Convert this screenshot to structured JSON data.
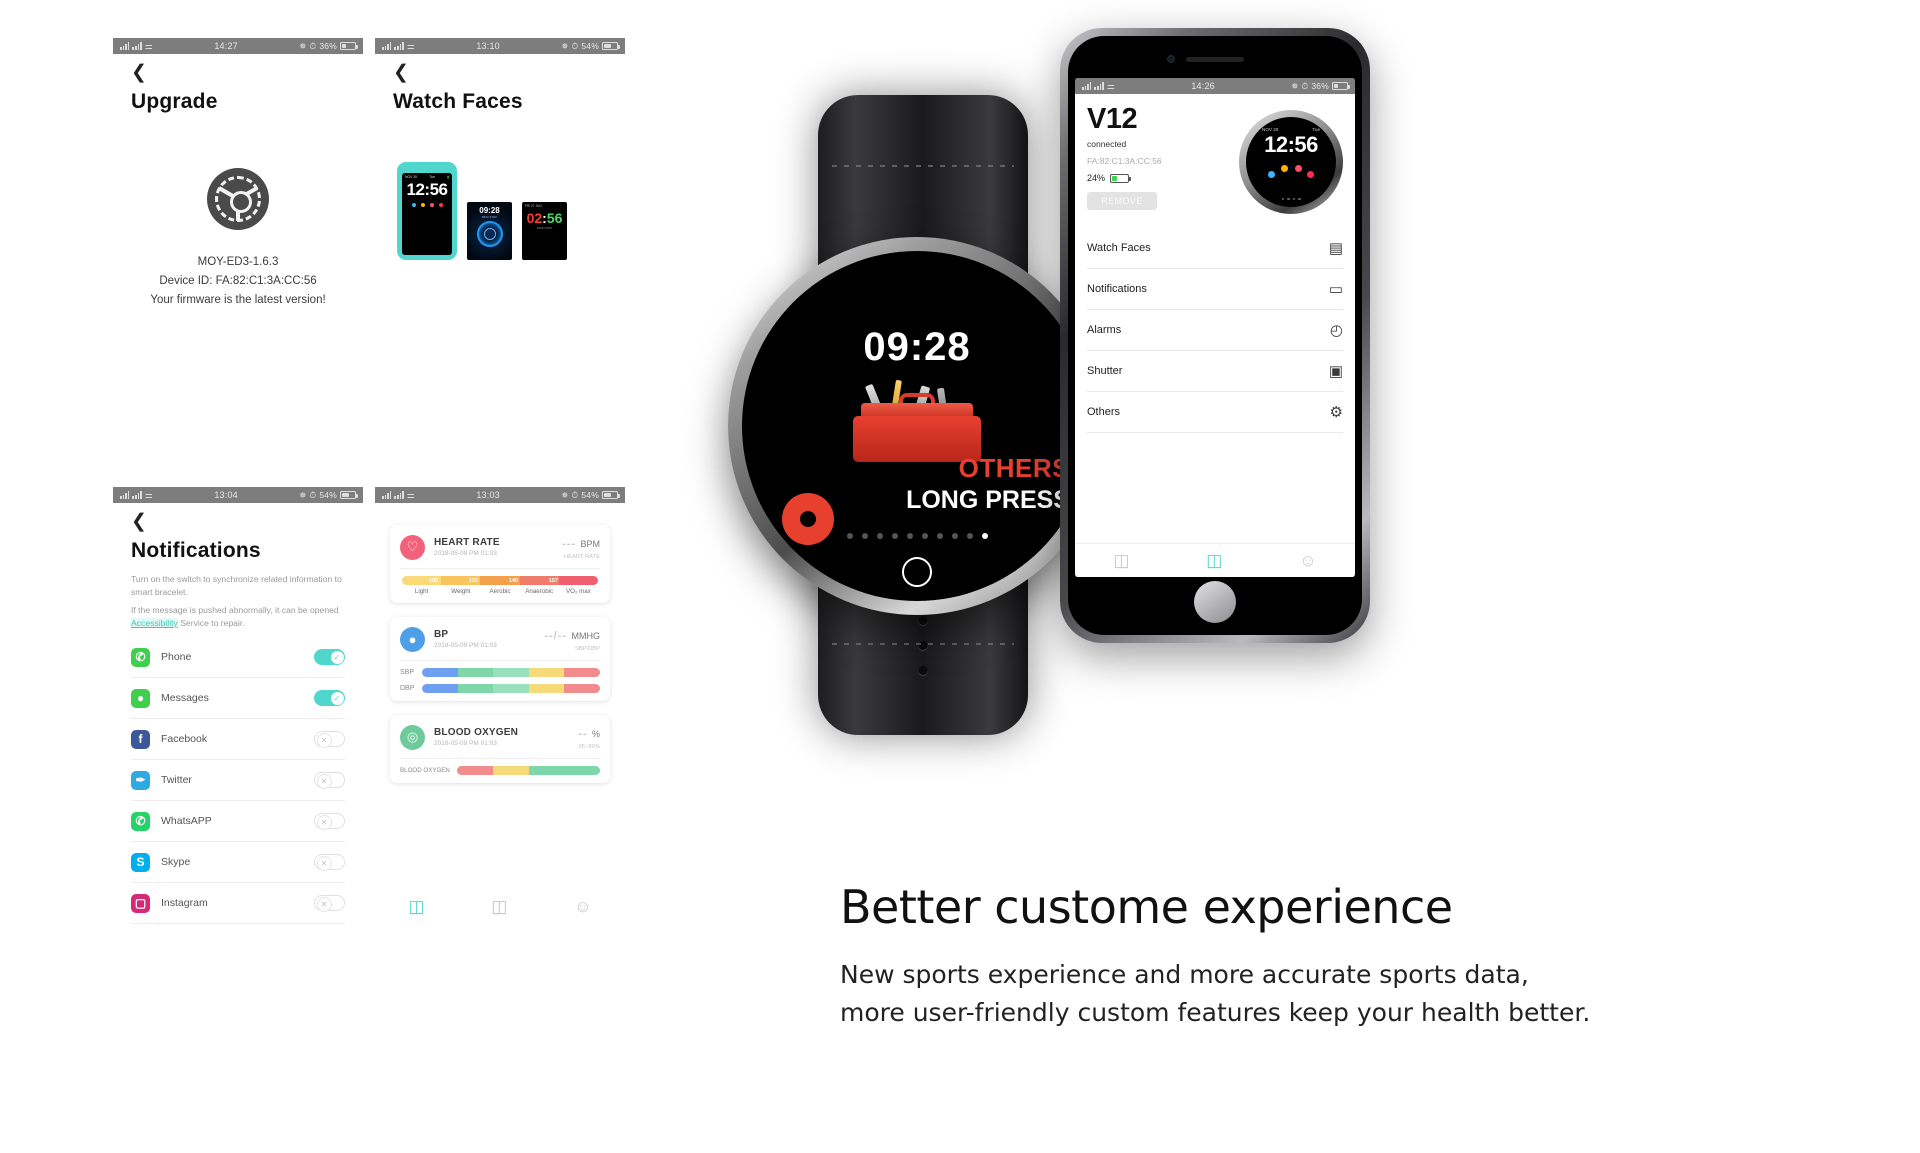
{
  "panels": {
    "upgrade": {
      "status": {
        "time": "14:27",
        "battery_pct": "36%"
      },
      "title": "Upgrade",
      "icon": "gear-icon",
      "firmware_version": "MOY-ED3-1.6.3",
      "device_id": "Device ID: FA:82:C1:3A:CC:56",
      "status_text": "Your firmware is the latest version!"
    },
    "watch_faces": {
      "status": {
        "time": "13:10",
        "battery_pct": "54%"
      },
      "title": "Watch Faces",
      "faces": [
        {
          "name": "face-digital-teal",
          "date": "NOV 20",
          "day": "Tue",
          "time": "12:56",
          "selected": true
        },
        {
          "name": "face-blue-ring",
          "date": "MON 29",
          "time": "09:28",
          "sub": "8834 STEP"
        },
        {
          "name": "face-color-digits",
          "date": "FRI 27 JUN",
          "time": "02:56",
          "sub": "6998 STEP"
        }
      ]
    },
    "notifications": {
      "status": {
        "time": "13:04",
        "battery_pct": "54%"
      },
      "title": "Notifications",
      "desc_1": "Turn on the switch to synchronize related information to smart bracelet.",
      "desc_2_pre": "If the message is pushed abnormally, it can be opened ",
      "desc_2_link": "Accessibility",
      "desc_2_post": " Service to repair.",
      "apps": [
        {
          "name": "Phone",
          "icon": "phone-icon",
          "color": "#3ecf4c",
          "glyph": "✆",
          "enabled": true
        },
        {
          "name": "Messages",
          "icon": "messages-icon",
          "color": "#3ecf4c",
          "glyph": "●",
          "enabled": true
        },
        {
          "name": "Facebook",
          "icon": "facebook-icon",
          "color": "#3b5998",
          "glyph": "f",
          "enabled": false
        },
        {
          "name": "Twitter",
          "icon": "twitter-icon",
          "color": "#2daae1",
          "glyph": "✒",
          "enabled": false
        },
        {
          "name": "WhatsAPP",
          "icon": "whatsapp-icon",
          "color": "#25d366",
          "glyph": "✆",
          "enabled": false
        },
        {
          "name": "Skype",
          "icon": "skype-icon",
          "color": "#00aff0",
          "glyph": "S",
          "enabled": false
        },
        {
          "name": "Instagram",
          "icon": "instagram-icon",
          "color": "#d62976",
          "glyph": "▢",
          "enabled": false
        }
      ]
    },
    "health": {
      "status": {
        "time": "13:03",
        "battery_pct": "54%"
      },
      "cards": [
        {
          "title": "HEART RATE",
          "icon": "heart-rate-icon",
          "icon_color": "#f4617a",
          "date": "2018-05-09 PM 01:03",
          "value": "---",
          "unit": "BPM",
          "sub": "HEART RATE",
          "zones": [
            {
              "label": "Light",
              "num": "105",
              "color": "#fbd977"
            },
            {
              "label": "Weight",
              "num": "122",
              "color": "#f9c45e"
            },
            {
              "label": "Aerobic",
              "num": "140",
              "color": "#f5a04a"
            },
            {
              "label": "Anaerobic",
              "num": "157",
              "color": "#f07d6b"
            },
            {
              "label": "VO₂ max",
              "num": "",
              "color": "#ef5f6e"
            }
          ]
        },
        {
          "title": "BP",
          "icon": "blood-pressure-icon",
          "icon_color": "#4f9ee8",
          "date": "2018-05-09 PM 01:03",
          "value": "--/--",
          "unit": "MMHG",
          "sub": "SBP/DBP",
          "bars": [
            {
              "label": "SBP",
              "segments": [
                "#6f9ff0",
                "#7fd6a8",
                "#9be0bd",
                "#f6d978",
                "#f28b8b"
              ]
            },
            {
              "label": "DBP",
              "segments": [
                "#6f9ff0",
                "#7fd6a8",
                "#9be0bd",
                "#f6d978",
                "#f28b8b"
              ]
            }
          ]
        },
        {
          "title": "BLOOD OXYGEN",
          "icon": "blood-oxygen-icon",
          "icon_color": "#6ec99b",
          "date": "2018-05-09 PM 01:03",
          "value": "--",
          "unit": "%",
          "sub": "95~99%",
          "bars": [
            {
              "label": "BLOOD OXYGEN",
              "segments": [
                "#f28b8b",
                "#f6d978",
                "#7fd6a8",
                "#7fd6a8"
              ]
            }
          ]
        }
      ],
      "tabs": [
        "device-tab",
        "data-tab",
        "profile-tab"
      ]
    }
  },
  "watch_hero": {
    "time": "09:28",
    "label_top": "OTHERS",
    "label_bottom": "LONG PRESS",
    "icon": "toolbox-icon",
    "dots_total": 10,
    "dots_active_index": 9
  },
  "phone": {
    "status": {
      "time": "14:26",
      "battery_pct": "36%"
    },
    "device_name": "V12",
    "connection": "connected",
    "mac": "FA:82:C1:3A:CC:56",
    "battery_pct": "24%",
    "remove_label": "REMOVE",
    "watch_preview": {
      "date": "NOV 20",
      "day": "Tue",
      "time": "12:56"
    },
    "menu": [
      {
        "label": "Watch Faces",
        "icon": "watch-face-icon"
      },
      {
        "label": "Notifications",
        "icon": "chat-bubble-icon"
      },
      {
        "label": "Alarms",
        "icon": "clock-icon"
      },
      {
        "label": "Shutter",
        "icon": "camera-icon"
      },
      {
        "label": "Others",
        "icon": "gear-icon"
      }
    ],
    "tabs": [
      "data-tab",
      "device-tab",
      "profile-tab"
    ]
  },
  "marketing": {
    "headline": "Better custome experience",
    "line1": "New sports experience and more accurate sports data,",
    "line2": "more user-friendly custom features keep your health better."
  }
}
